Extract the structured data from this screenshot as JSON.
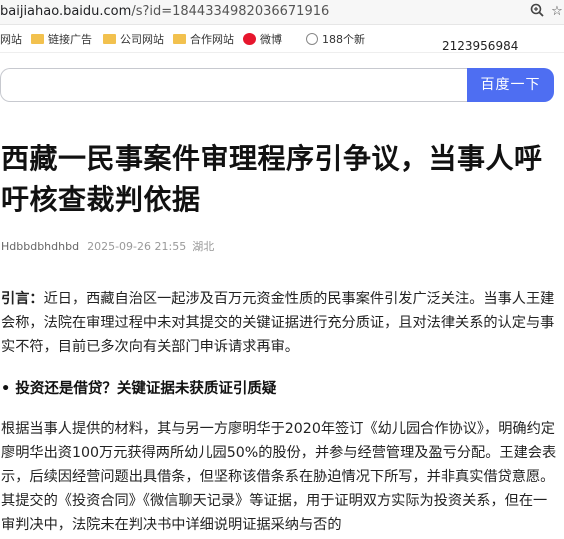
{
  "browser": {
    "url_host": "baijiahao.baidu.com",
    "url_rest": "/s?id=1844334982036671916",
    "bookmarks": [
      "网站",
      "链接广告",
      "公司网站",
      "合作网站",
      "微博",
      "188个新"
    ],
    "phone": "2123956984"
  },
  "search": {
    "button_label": "百度一下",
    "placeholder": ""
  },
  "article": {
    "title": "西藏一民事案件审理程序引争议，当事人呼吁核查裁判依据",
    "author": "Hdbbdbhdhbd",
    "date": "2025-09-26 21:55",
    "location": "湖北",
    "lead_label": "引言：",
    "lead_text": "近日，西藏自治区一起涉及百万元资金性质的民事案件引发广泛关注。当事人王建会称，法院在审理过程中未对其提交的关键证据进行充分质证，且对法律关系的认定与事实不符，目前已多次向有关部门申诉请求再审。",
    "section_heading": "• 投资还是借贷？关键证据未获质证引质疑",
    "body_text": "根据当事人提供的材料，其与另一方廖明华于2020年签订《幼儿园合作协议》，明确约定廖明华出资100万元获得两所幼儿园50%的股份，并参与经营管理及盈亏分配。王建会表示，后续因经营问题出具借条，但坚称该借条系在胁迫情况下所写，并非真实借贷意愿。其提交的《投资合同》《微信聊天记录》等证据，用于证明双方实际为投资关系，但在一审判决中，法院未在判决书中详细说明证据采纳与否的"
  }
}
